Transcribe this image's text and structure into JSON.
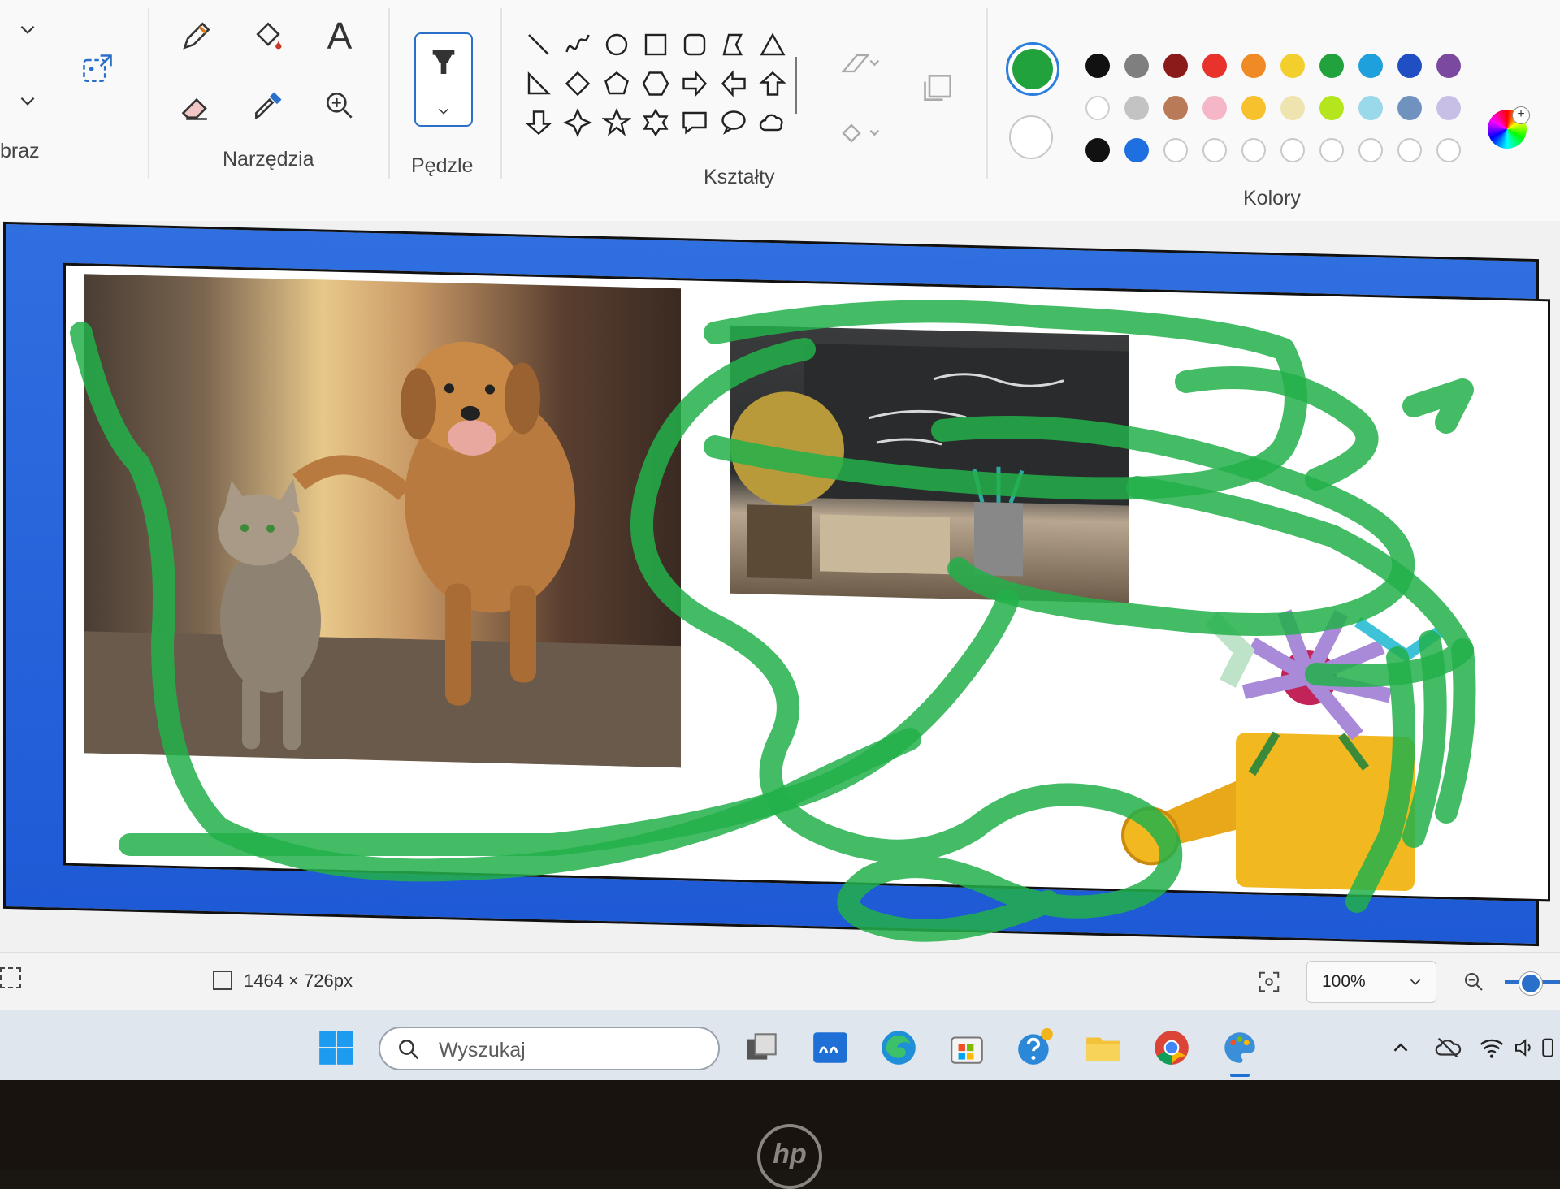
{
  "ribbon": {
    "image_label_partial": "braz",
    "tools_label": "Narzędzia",
    "brushes_label": "Pędzle",
    "shapes_label": "Kształty",
    "colors_label": "Kolory",
    "text_tool_glyph": "A"
  },
  "colors": {
    "color1": "#22a23c",
    "row1": [
      "#111111",
      "#7f7f7f",
      "#8b1a1a",
      "#e8322c",
      "#f08a24",
      "#f2cf2c",
      "#22a23c",
      "#1ea0dc",
      "#1f4fc2",
      "#7b4aa0"
    ],
    "row2": [
      "#ffffff",
      "#c3c3c3",
      "#b97a57",
      "#f5b6c8",
      "#f6c12c",
      "#efe4b0",
      "#b5e61d",
      "#99d9ea",
      "#7092be",
      "#c8bfe7"
    ],
    "row3": [
      "#111111",
      "#1e6fe0"
    ]
  },
  "status": {
    "canvas_size": "1464 × 726px",
    "zoom": "100%"
  },
  "taskbar": {
    "search_placeholder": "Wyszukaj"
  },
  "bezel": {
    "brand": "hp"
  }
}
